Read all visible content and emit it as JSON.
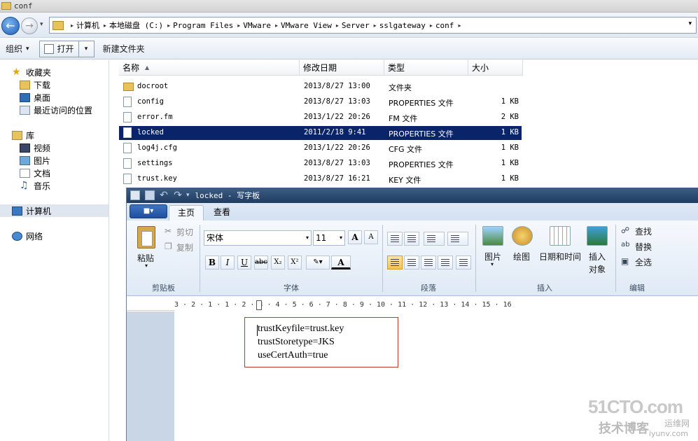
{
  "explorer": {
    "title": "conf",
    "breadcrumbs": [
      "计算机",
      "本地磁盘 (C:)",
      "Program Files",
      "VMware",
      "VMware View",
      "Server",
      "sslgateway",
      "conf"
    ],
    "toolbar": {
      "organize": "组织",
      "open": "打开",
      "new_folder": "新建文件夹"
    },
    "sidebar": {
      "favorites": "收藏夹",
      "downloads": "下载",
      "desktop": "桌面",
      "recent": "最近访问的位置",
      "libraries": "库",
      "videos": "视频",
      "pictures": "图片",
      "documents": "文档",
      "music": "音乐",
      "computer": "计算机",
      "network": "网络"
    },
    "columns": {
      "name": "名称",
      "modified": "修改日期",
      "type": "类型",
      "size": "大小"
    },
    "files": [
      {
        "name": "docroot",
        "modified": "2013/8/27 13:00",
        "type": "文件夹",
        "size": "",
        "icon": "folder-icon"
      },
      {
        "name": "config",
        "modified": "2013/8/27 13:03",
        "type": "PROPERTIES 文件",
        "size": "1 KB",
        "icon": "file-icon"
      },
      {
        "name": "error.fm",
        "modified": "2013/1/22 20:26",
        "type": "FM 文件",
        "size": "2 KB",
        "icon": "file-icon"
      },
      {
        "name": "locked",
        "modified": "2011/2/18 9:41",
        "type": "PROPERTIES 文件",
        "size": "1 KB",
        "icon": "file-icon",
        "selected": true
      },
      {
        "name": "log4j.cfg",
        "modified": "2013/1/22 20:26",
        "type": "CFG 文件",
        "size": "1 KB",
        "icon": "file-icon"
      },
      {
        "name": "settings",
        "modified": "2013/8/27 13:03",
        "type": "PROPERTIES 文件",
        "size": "1 KB",
        "icon": "file-icon"
      },
      {
        "name": "trust.key",
        "modified": "2013/8/27 16:21",
        "type": "KEY 文件",
        "size": "1 KB",
        "icon": "file-icon"
      }
    ]
  },
  "wordpad": {
    "title": "locked - 写字板",
    "tabs": {
      "home": "主页",
      "view": "查看"
    },
    "clipboard": {
      "paste": "粘贴",
      "cut": "剪切",
      "copy": "复制",
      "label": "剪贴板"
    },
    "font": {
      "family": "宋体",
      "size": "11",
      "label": "字体"
    },
    "paragraph": {
      "label": "段落"
    },
    "insert": {
      "picture": "图片",
      "paint": "绘图",
      "datetime": "日期和时间",
      "object_1": "插入",
      "object_2": "对象",
      "label": "插入"
    },
    "editing": {
      "find": "查找",
      "replace": "替换",
      "select_all": "全选",
      "label": "编辑"
    },
    "ruler": "3 · 2 · 1 · 1 · 2 · 3 · 4 · 5 · 6 · 7 · 8 · 9 · 10 · 11 · 12 · 13 · 14 · 15 · 16",
    "document": [
      "trustKeyfile=trust.key",
      "trustStoretype=JKS",
      "useCertAuth=true"
    ]
  },
  "watermark": {
    "site": "51CTO.com",
    "tech": "技术博客",
    "blog": "运维网",
    "domain": "iyunv.com"
  },
  "colors": {
    "selection": "#0a246a",
    "highlight_box": "#c0392b",
    "wordpad_title": "#1f3b61"
  }
}
